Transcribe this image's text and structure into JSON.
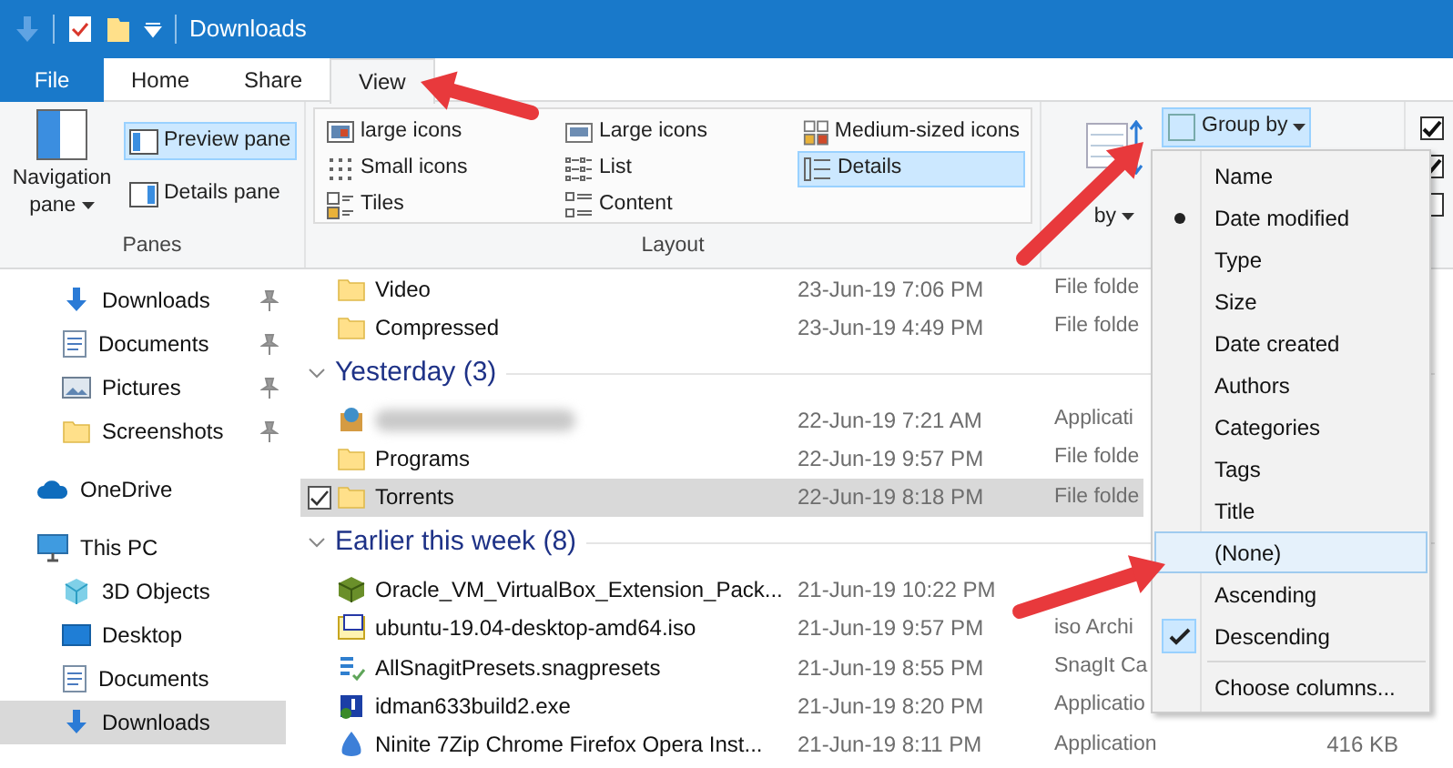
{
  "title_bar": {
    "title": "Downloads"
  },
  "ribbon": {
    "tabs": [
      {
        "label": "File",
        "kind": "file",
        "selected": false
      },
      {
        "label": "Home",
        "kind": "tab",
        "selected": false
      },
      {
        "label": "Share",
        "kind": "tab",
        "selected": false
      },
      {
        "label": "View",
        "kind": "tab",
        "selected": true
      }
    ],
    "panes": {
      "navigation_pane": "Navigation pane",
      "buttons": [
        {
          "label": "Preview pane",
          "selected": true
        },
        {
          "label": "Details pane",
          "selected": false
        }
      ],
      "group_label": "Panes"
    },
    "layout": {
      "options": [
        {
          "label": "large icons",
          "selected": false
        },
        {
          "label": "Small icons",
          "selected": false
        },
        {
          "label": "Tiles",
          "selected": false
        },
        {
          "label": "Large icons",
          "selected": false
        },
        {
          "label": "List",
          "selected": false
        },
        {
          "label": "Content",
          "selected": false
        },
        {
          "label": "Medium-sized icons",
          "selected": false
        },
        {
          "label": "Details",
          "selected": true
        }
      ],
      "group_label": "Layout"
    },
    "current_view": {
      "sort_by": "by",
      "group_by": {
        "label": "Group by",
        "selected": true
      }
    },
    "checkboxes": [
      {
        "checked": true
      },
      {
        "checked": true
      },
      {
        "checked": false
      }
    ]
  },
  "navigation": [
    {
      "label": "Downloads",
      "kind": "download",
      "pinned": true,
      "selected": false
    },
    {
      "label": "Documents",
      "kind": "document",
      "pinned": true,
      "selected": false
    },
    {
      "label": "Pictures",
      "kind": "picture",
      "pinned": true,
      "selected": false
    },
    {
      "label": "Screenshots",
      "kind": "folder",
      "pinned": true,
      "selected": false
    },
    {
      "label": "OneDrive",
      "kind": "cloud",
      "pinned": false,
      "selected": false
    },
    {
      "label": "This PC",
      "kind": "computer",
      "pinned": false,
      "selected": false
    },
    {
      "label": "3D Objects",
      "kind": "cube",
      "pinned": false,
      "selected": false
    },
    {
      "label": "Desktop",
      "kind": "desktop",
      "pinned": false,
      "selected": false
    },
    {
      "label": "Documents",
      "kind": "document",
      "pinned": false,
      "selected": false
    },
    {
      "label": "Downloads",
      "kind": "download",
      "pinned": false,
      "selected": true
    }
  ],
  "file_list": {
    "groups": [
      {
        "items": [
          {
            "name": "Video",
            "kind": "folder",
            "modified": "23-Jun-19 7:06 PM",
            "type": "File folde",
            "selected": false
          },
          {
            "name": "Compressed",
            "kind": "folder",
            "modified": "23-Jun-19 4:49 PM",
            "type": "File folde",
            "selected": false
          }
        ]
      },
      {
        "title": "Yesterday (3)",
        "items": [
          {
            "kind": "application",
            "blurred": true,
            "modified": "22-Jun-19 7:21 AM",
            "type": "Applicati",
            "selected": false
          },
          {
            "name": "Programs",
            "kind": "folder",
            "modified": "22-Jun-19 9:57 PM",
            "type": "File folde",
            "selected": false
          },
          {
            "name": "Torrents",
            "kind": "folder",
            "modified": "22-Jun-19 8:18 PM",
            "type": "File folde",
            "selected": true
          }
        ]
      },
      {
        "title": "Earlier this week (8)",
        "items": [
          {
            "name": "Oracle_VM_VirtualBox_Extension_Pack...",
            "kind": "package",
            "modified": "21-Jun-19 10:22 PM",
            "selected": false
          },
          {
            "name": "ubuntu-19.04-desktop-amd64.iso",
            "kind": "disc",
            "modified": "21-Jun-19 9:57 PM",
            "type": "iso Archi",
            "selected": false
          },
          {
            "name": "AllSnagitPresets.snagpresets",
            "kind": "preset",
            "modified": "21-Jun-19 8:55 PM",
            "type": "SnagIt Ca",
            "selected": false
          },
          {
            "name": "idman633build2.exe",
            "kind": "executable",
            "modified": "21-Jun-19 8:20 PM",
            "type": "Applicatio",
            "selected": false
          },
          {
            "name": "Ninite 7Zip Chrome Firefox Opera Inst...",
            "kind": "installer",
            "modified": "21-Jun-19 8:11 PM",
            "type": "Application",
            "size": "416 KB",
            "selected": false
          }
        ]
      }
    ]
  },
  "group_menu": {
    "items": [
      {
        "kind": "item",
        "label": "Name",
        "bullet": false,
        "checked": false,
        "hovered": false
      },
      {
        "kind": "item",
        "label": "Date modified",
        "bullet": true,
        "checked": false,
        "hovered": false
      },
      {
        "kind": "item",
        "label": "Type",
        "bullet": false,
        "checked": false,
        "hovered": false
      },
      {
        "kind": "item",
        "label": "Size",
        "bullet": false,
        "checked": false,
        "hovered": false
      },
      {
        "kind": "item",
        "label": "Date created",
        "bullet": false,
        "checked": false,
        "hovered": false
      },
      {
        "kind": "item",
        "label": "Authors",
        "bullet": false,
        "checked": false,
        "hovered": false
      },
      {
        "kind": "item",
        "label": "Categories",
        "bullet": false,
        "checked": false,
        "hovered": false
      },
      {
        "kind": "item",
        "label": "Tags",
        "bullet": false,
        "checked": false,
        "hovered": false
      },
      {
        "kind": "item",
        "label": "Title",
        "bullet": false,
        "checked": false,
        "hovered": false
      },
      {
        "kind": "item",
        "label": "(None)",
        "bullet": false,
        "checked": false,
        "hovered": true
      },
      {
        "kind": "item",
        "label": "Ascending",
        "bullet": false,
        "checked": false,
        "hovered": false
      },
      {
        "kind": "item",
        "label": "Descending",
        "bullet": false,
        "checked": true,
        "hovered": false
      },
      {
        "kind": "separator"
      },
      {
        "kind": "item",
        "label": "Choose columns...",
        "bullet": false,
        "checked": false,
        "hovered": false
      }
    ]
  },
  "annotations": [
    {
      "kind": "arrow"
    },
    {
      "kind": "arrow"
    },
    {
      "kind": "arrow"
    }
  ]
}
